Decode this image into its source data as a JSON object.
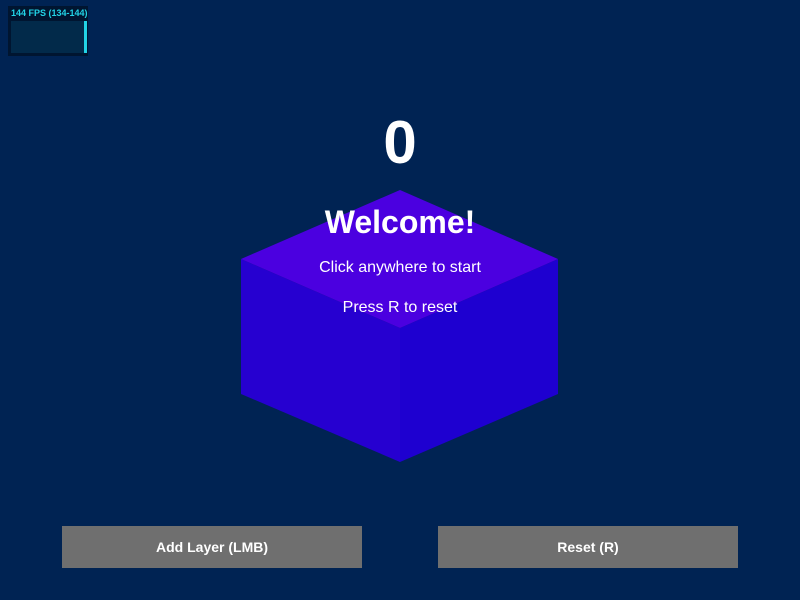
{
  "fps": {
    "label": "144 FPS (134-144)"
  },
  "game": {
    "score": "0",
    "title": "Welcome!",
    "hint_start": "Click anywhere to start",
    "hint_reset": "Press R to reset"
  },
  "buttons": {
    "add_layer": "Add Layer (LMB)",
    "reset": "Reset (R)"
  },
  "colors": {
    "background": "#002353",
    "cube_top": "#4b00e0",
    "cube_left": "#2600d0",
    "cube_right": "#1e00d0",
    "button": "#6f6f6f",
    "fps_accent": "#22d3e6"
  }
}
